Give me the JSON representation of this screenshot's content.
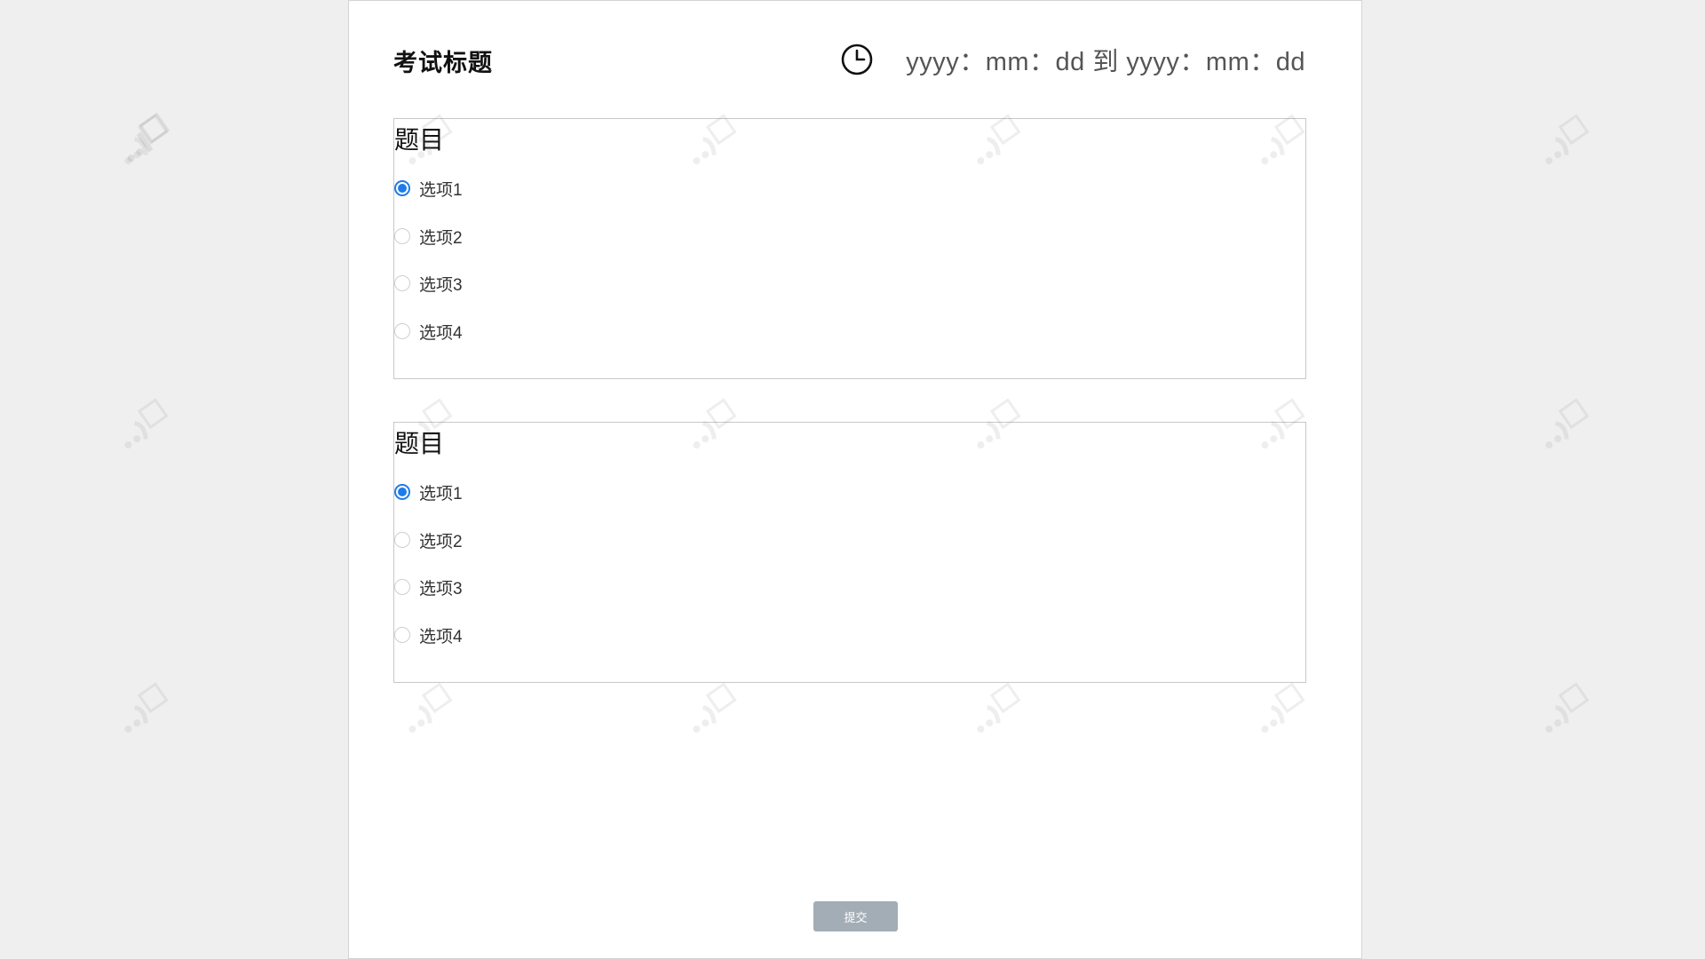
{
  "exam": {
    "title": "考试标题",
    "time_range": "yyyy：mm：dd 到 yyyy：mm：dd",
    "clock_icon": "clock-icon"
  },
  "questions": [
    {
      "title": "题目",
      "options": [
        "选项1",
        "选项2",
        "选项3",
        "选项4"
      ],
      "selected_index": 0
    },
    {
      "title": "题目",
      "options": [
        "选项1",
        "选项2",
        "选项3",
        "选项4"
      ],
      "selected_index": 0
    }
  ],
  "submit_label": "提交",
  "colors": {
    "accent": "#1e7ce8",
    "submit_bg": "#a3adb6",
    "page_bg": "#efefef"
  }
}
